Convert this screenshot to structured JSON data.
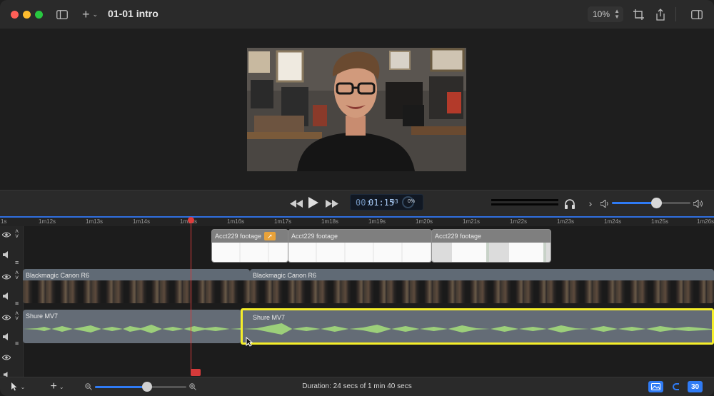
{
  "window": {
    "title": "01-01 intro"
  },
  "toolbar": {
    "zoom_value": "10%"
  },
  "transport": {
    "timecode_prefix": "00:",
    "timecode_main": "01:15",
    "timecode_frames": "03",
    "render_percent": "0%",
    "volume_level": 0.56
  },
  "ruler": {
    "ticks": [
      "1s",
      "1m12s",
      "1m13s",
      "1m14s",
      "1m15s",
      "1m16s",
      "1m17s",
      "1m18s",
      "1m19s",
      "1m20s",
      "1m21s",
      "1m22s",
      "1m23s",
      "1m24s",
      "1m25s",
      "1m26s"
    ]
  },
  "tracks": {
    "overlay_clips": [
      "Acct229 footage",
      "Acct229 footage",
      "Acct229 footage"
    ],
    "video_clips": [
      "Blackmagic Canon R6",
      "Blackmagic Canon R6"
    ],
    "audio_clips": [
      "Shure MV7",
      "Shure MV7"
    ]
  },
  "bottom": {
    "duration": "Duration: 24 secs of 1 min 40 secs",
    "zoom_level": 0.57,
    "badge_30": "30"
  },
  "colors": {
    "accent": "#2f7bf5",
    "selection": "#f5ee2a",
    "playhead": "#d63a3a",
    "waveform": "#9ccf7a"
  }
}
